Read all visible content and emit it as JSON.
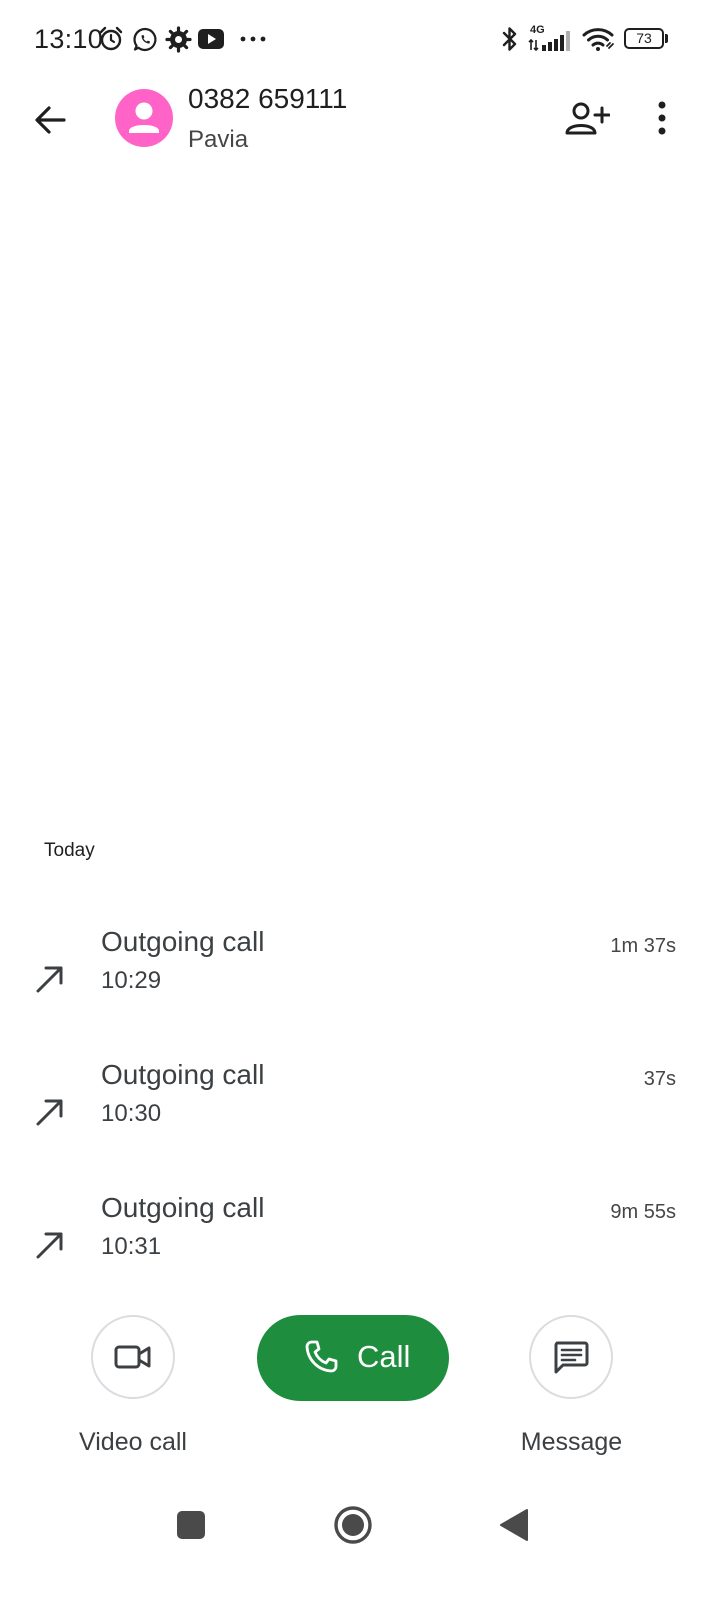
{
  "status_bar": {
    "time": "13:10",
    "battery_level": "73",
    "network_type": "4G",
    "icons": [
      "alarm-icon",
      "whatsapp-icon",
      "gear-status-icon",
      "youtube-icon",
      "more-notifications-icon",
      "bluetooth-icon",
      "cellular-signal-icon",
      "wifi-icon",
      "battery-icon"
    ]
  },
  "app_bar": {
    "back_icon": "arrow-back-icon",
    "contact_number": "0382 659111",
    "contact_location": "Pavia",
    "avatar_color": "#ff63c8",
    "add_contact_icon": "add-person-icon",
    "more_icon": "more-vert-icon"
  },
  "history": {
    "section_label": "Today",
    "calls": [
      {
        "type": "Outgoing call",
        "time": "10:29",
        "duration": "1m 37s",
        "icon": "call-made-icon"
      },
      {
        "type": "Outgoing call",
        "time": "10:30",
        "duration": "37s",
        "icon": "call-made-icon"
      },
      {
        "type": "Outgoing call",
        "time": "10:31",
        "duration": "9m 55s",
        "icon": "call-made-icon"
      }
    ]
  },
  "actions": {
    "video_call_label": "Video call",
    "call_label": "Call",
    "message_label": "Message",
    "call_button_color": "#1e8e3e"
  },
  "nav_bar": {
    "icons": [
      "recents-square-icon",
      "home-circle-icon",
      "back-triangle-icon"
    ]
  }
}
